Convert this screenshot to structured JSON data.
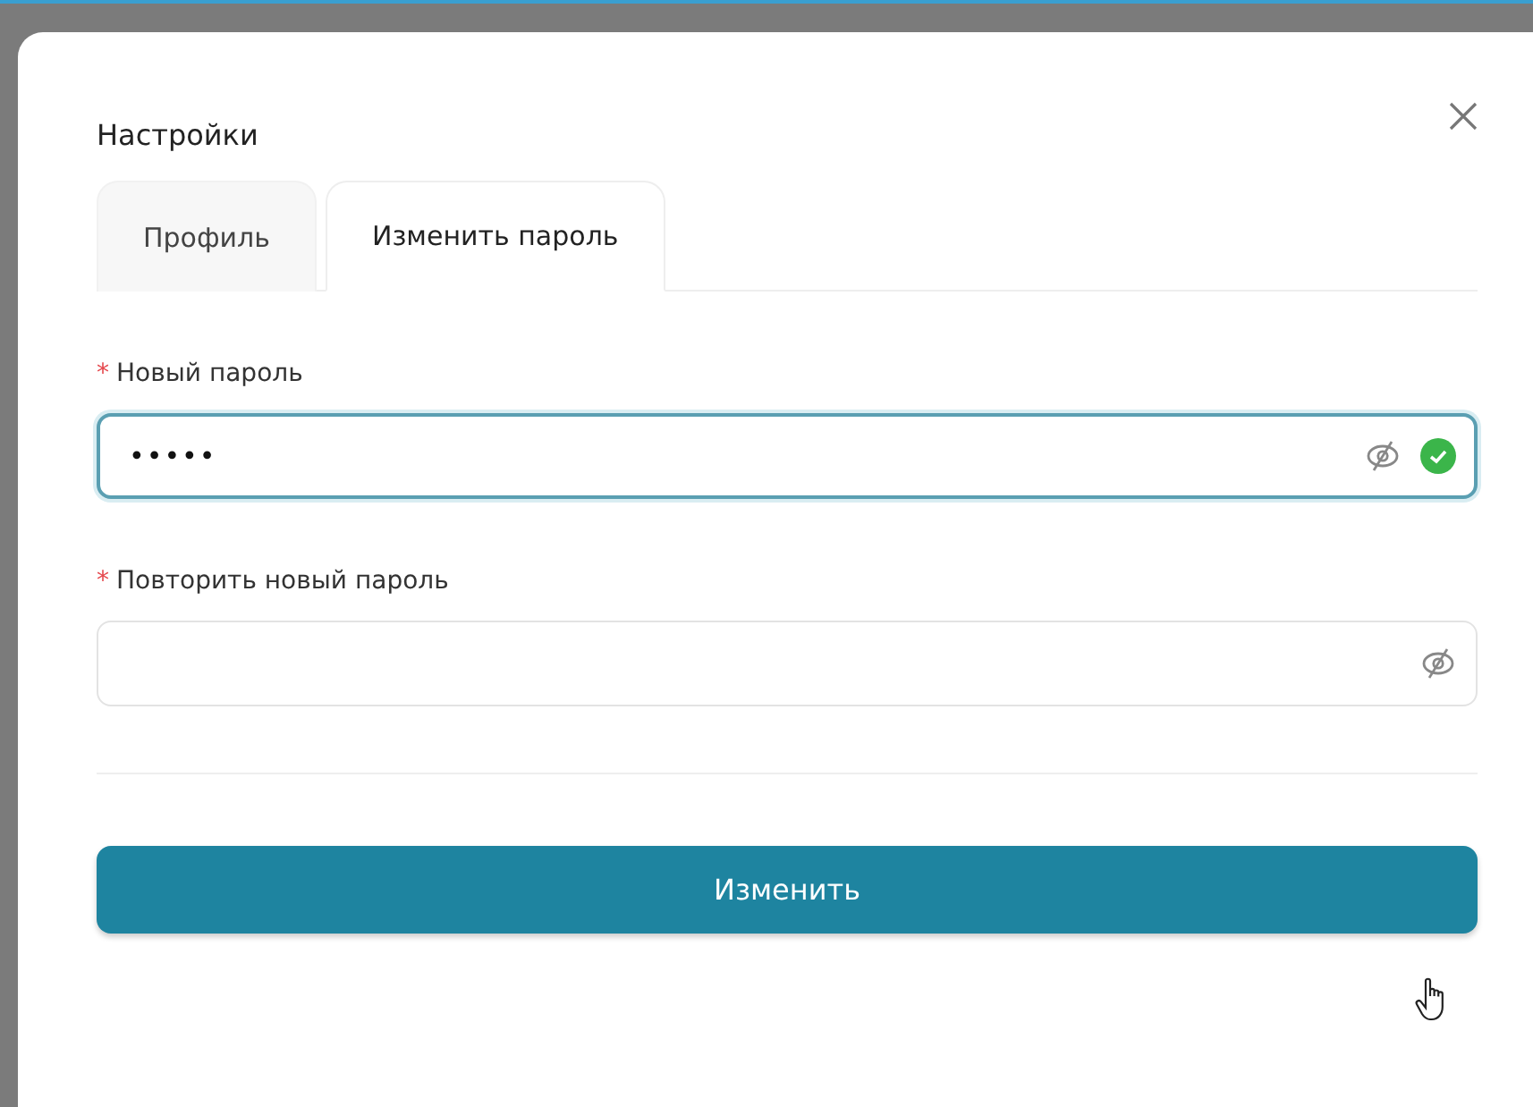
{
  "dialog": {
    "title": "Настройки"
  },
  "tabs": [
    {
      "label": "Профиль",
      "selected": false
    },
    {
      "label": "Изменить пароль",
      "selected": true
    }
  ],
  "fields": [
    {
      "label": "Новый пароль",
      "required_mark": "*",
      "value": "•••••",
      "focused": true,
      "valid": true
    },
    {
      "label": "Повторить новый пароль",
      "required_mark": "*",
      "focused": false,
      "valid": false
    }
  ],
  "submit": {
    "label": "Изменить"
  }
}
